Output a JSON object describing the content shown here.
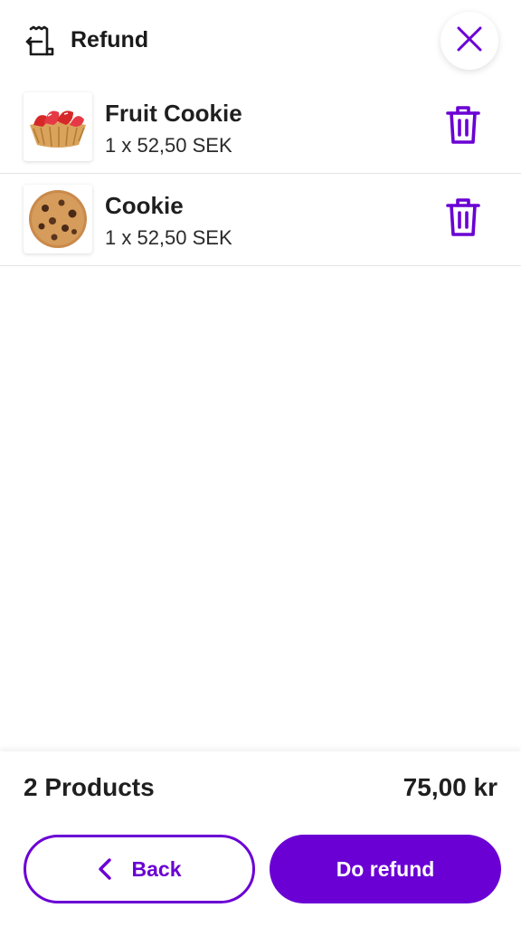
{
  "header": {
    "title": "Refund",
    "icon": "receipt-return-icon",
    "close_icon": "close-icon"
  },
  "items": [
    {
      "name": "Fruit Cookie",
      "detail": "1 x 52,50 SEK",
      "image": "strawberry-tart-image"
    },
    {
      "name": "Cookie",
      "detail": "1 x 52,50 SEK",
      "image": "chocolate-chip-cookie-image"
    }
  ],
  "summary": {
    "count_label": "2 Products",
    "total": "75,00 kr"
  },
  "actions": {
    "back_label": "Back",
    "refund_label": "Do refund"
  },
  "colors": {
    "accent": "#6a00d4"
  }
}
